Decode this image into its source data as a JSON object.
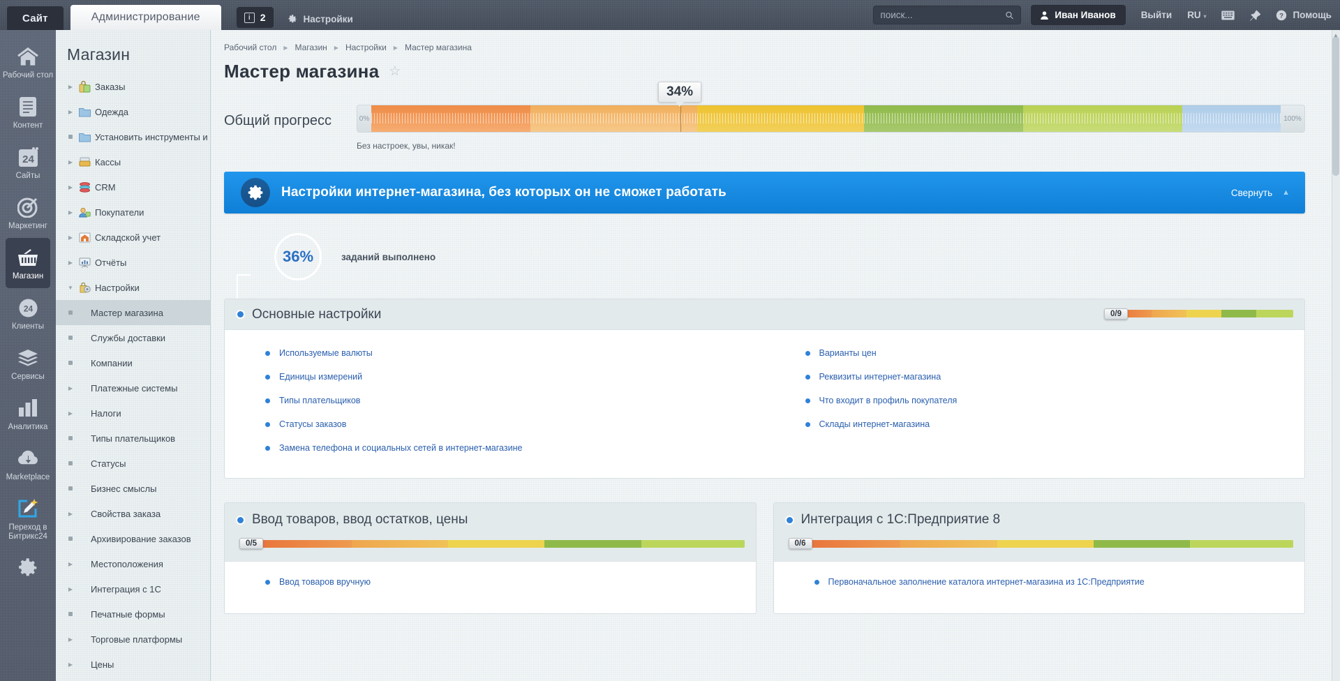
{
  "topbar": {
    "tab_site": "Сайт",
    "tab_admin": "Администрирование",
    "counter_value": "2",
    "counter_icon": "info-icon",
    "settings_label": "Настройки",
    "settings_icon": "gear-icon",
    "search_placeholder": "поиск...",
    "search_value": "",
    "search_icon": "search-icon",
    "user_name": "Иван Иванов",
    "user_icon": "person-icon",
    "logout_label": "Выйти",
    "lang_label": "RU",
    "keyboard_icon": "keyboard-icon",
    "pin_icon": "pin-icon",
    "help_label": "Помощь",
    "help_icon": "question-circle-icon"
  },
  "rail": {
    "items": [
      {
        "label": "Рабочий стол",
        "icon": "home-icon",
        "active": false
      },
      {
        "label": "Контент",
        "icon": "document-icon",
        "active": false
      },
      {
        "label": "Сайты",
        "icon": "window24-icon",
        "active": false
      },
      {
        "label": "Маркетинг",
        "icon": "target-icon",
        "active": false
      },
      {
        "label": "Магазин",
        "icon": "basket-icon",
        "active": true
      },
      {
        "label": "Клиенты",
        "icon": "circle24-icon",
        "active": false
      },
      {
        "label": "Сервисы",
        "icon": "layers-icon",
        "active": false
      },
      {
        "label": "Аналитика",
        "icon": "bar-chart-icon",
        "active": false
      },
      {
        "label": "Marketplace",
        "icon": "cloud-download-icon",
        "active": false
      },
      {
        "label": "Переход в Битрикс24",
        "icon": "magic-pencil-icon",
        "active": false
      },
      {
        "label": "",
        "icon": "gear-icon",
        "active": false
      }
    ]
  },
  "sidebar": {
    "title": "Магазин",
    "items": [
      {
        "label": "Заказы",
        "marker": "arrow",
        "icon": "orders-icon",
        "selected": false
      },
      {
        "label": "Одежда",
        "marker": "arrow",
        "icon": "folder-icon",
        "selected": false
      },
      {
        "label": "Установить инструменты и",
        "marker": "dot",
        "icon": "folder-icon",
        "selected": false
      },
      {
        "label": "Кассы",
        "marker": "arrow",
        "icon": "cashbox-icon",
        "selected": false
      },
      {
        "label": "CRM",
        "marker": "arrow",
        "icon": "crm-icon",
        "selected": false
      },
      {
        "label": "Покупатели",
        "marker": "arrow",
        "icon": "buyers-icon",
        "selected": false
      },
      {
        "label": "Складской учет",
        "marker": "arrow",
        "icon": "warehouse-icon",
        "selected": false
      },
      {
        "label": "Отчёты",
        "marker": "arrow",
        "icon": "report-icon",
        "selected": false
      },
      {
        "label": "Настройки",
        "marker": "arrow-down",
        "icon": "settings-icon",
        "selected": false
      }
    ],
    "sub_items": [
      {
        "label": "Мастер магазина",
        "marker": "dot",
        "selected": true
      },
      {
        "label": "Службы доставки",
        "marker": "dot",
        "selected": false
      },
      {
        "label": "Компании",
        "marker": "dot",
        "selected": false
      },
      {
        "label": "Платежные системы",
        "marker": "arrow",
        "selected": false
      },
      {
        "label": "Налоги",
        "marker": "arrow",
        "selected": false
      },
      {
        "label": "Типы плательщиков",
        "marker": "dot",
        "selected": false
      },
      {
        "label": "Статусы",
        "marker": "dot",
        "selected": false
      },
      {
        "label": "Бизнес смыслы",
        "marker": "dot",
        "selected": false
      },
      {
        "label": "Свойства заказа",
        "marker": "arrow",
        "selected": false
      },
      {
        "label": "Архивирование заказов",
        "marker": "dot",
        "selected": false
      },
      {
        "label": "Местоположения",
        "marker": "arrow",
        "selected": false
      },
      {
        "label": "Интеграция с 1С",
        "marker": "arrow",
        "selected": false
      },
      {
        "label": "Печатные формы",
        "marker": "dot",
        "selected": false
      },
      {
        "label": "Торговые платформы",
        "marker": "arrow",
        "selected": false
      },
      {
        "label": "Цены",
        "marker": "arrow",
        "selected": false
      }
    ]
  },
  "breadcrumb": [
    "Рабочий стол",
    "Магазин",
    "Настройки",
    "Мастер магазина"
  ],
  "page": {
    "title": "Мастер магазина",
    "favorite_icon": "star-icon"
  },
  "overall_progress": {
    "caption": "Общий прогресс",
    "min_label": "0%",
    "max_label": "100%",
    "value_label": "34%",
    "value_percent": 34,
    "note": "Без настроек, увы, никак!"
  },
  "banner": {
    "icon": "gear-icon",
    "title": "Настройки интернет-магазина, без которых он не сможет работать",
    "collapse_label": "Свернуть",
    "collapse_icon": "chevron-up-icon",
    "accent_color": "#1484dd"
  },
  "summary": {
    "percent_label": "36%",
    "caption": "заданий выполнено"
  },
  "sections": [
    {
      "title": "Основные настройки",
      "progress_label": "0/9",
      "progress_percent": 0,
      "links_left": [
        "Используемые валюты",
        "Единицы измерений",
        "Типы плательщиков",
        "Статусы заказов",
        "Замена телефона и социальных сетей в интернет-магазине"
      ],
      "links_right": [
        "Варианты цен",
        "Реквизиты интернет-магазина",
        "Что входит в профиль покупателя",
        "Склады интернет-магазина"
      ]
    },
    {
      "title": "Ввод товаров, ввод остатков, цены",
      "progress_label": "0/5",
      "progress_percent": 0,
      "links_left": [
        "Ввод товаров вручную"
      ],
      "links_right": []
    },
    {
      "title": "Интеграция с 1С:Предприятие 8",
      "progress_label": "0/6",
      "progress_percent": 0,
      "links_left": [
        "Первоначальное заполнение каталога интернет-магазина из 1С:Предприятие"
      ],
      "links_right": []
    }
  ],
  "colors": {
    "brand_blue": "#1484dd",
    "link_blue": "#2a5fae",
    "rail_bg": "#5a6271",
    "topbar_bg": "#4a5260",
    "sidebar_bg": "#e3eaec",
    "content_bg": "#eaeff1"
  }
}
